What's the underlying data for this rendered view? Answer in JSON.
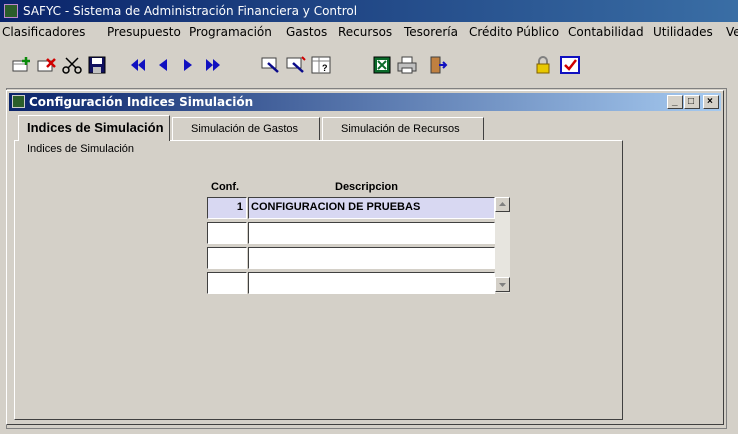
{
  "app": {
    "title": "SAFYC - Sistema de Administración Financiera y Control"
  },
  "menu": {
    "items": [
      "Clasificadores",
      "Presupuesto",
      "Programación",
      "Gastos",
      "Recursos",
      "Tesorería",
      "Crédito Público",
      "Contabilidad",
      "Utilidades",
      "Ve"
    ]
  },
  "toolbar": {
    "buttons": [
      "add-record-icon",
      "delete-record-icon",
      "cut-icon",
      "save-icon",
      "first-record-icon",
      "previous-record-icon",
      "next-record-icon",
      "last-record-icon",
      "query-icon",
      "execute-query-icon",
      "count-query-icon",
      "excel-icon",
      "print-icon",
      "exit-icon",
      "lock-icon",
      "checkbox-icon"
    ]
  },
  "window": {
    "title": "Configuración Indices Simulación",
    "controls": {
      "minimize": "_",
      "maximize": "□",
      "close": "×"
    }
  },
  "tabs": [
    {
      "label": "Indices de Simulación",
      "active": true
    },
    {
      "label": "Simulación de Gastos",
      "active": false
    },
    {
      "label": "Simulación de Recursos",
      "active": false
    }
  ],
  "panel": {
    "caption": "Indices de Simulación"
  },
  "grid": {
    "columns": [
      "Conf.",
      "Descripcion"
    ],
    "rows": [
      {
        "conf": "1",
        "descripcion": "CONFIGURACION DE PRUEBAS"
      },
      {
        "conf": "",
        "descripcion": ""
      },
      {
        "conf": "",
        "descripcion": ""
      },
      {
        "conf": "",
        "descripcion": ""
      }
    ]
  },
  "colors": {
    "titlebar": "#0a246a",
    "face": "#d4d0c8",
    "selected_row": "#d8d8f2"
  }
}
